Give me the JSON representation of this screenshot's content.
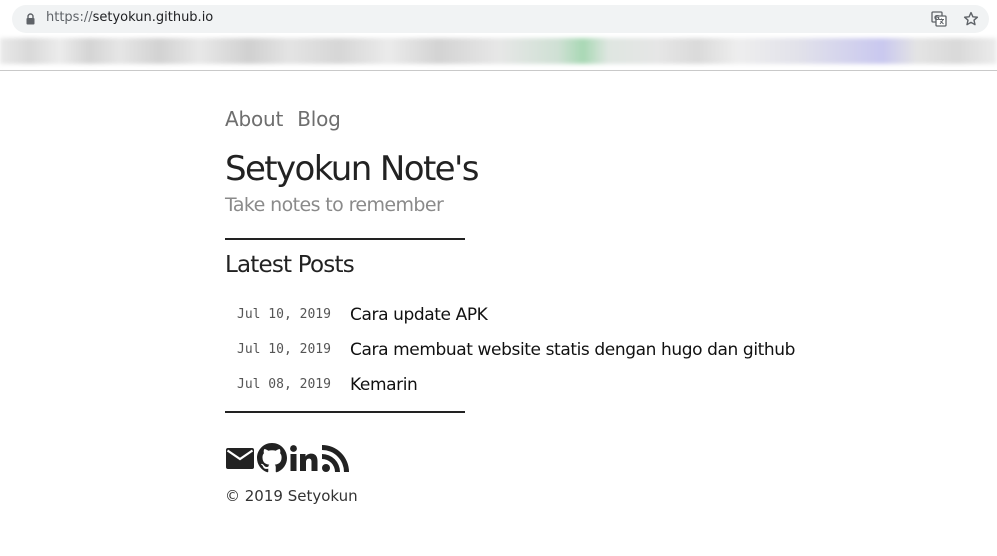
{
  "browser": {
    "url_scheme": "https://",
    "url_host": "setyokun.github.io",
    "icons": [
      "lock-icon",
      "translate-icon",
      "star-icon"
    ]
  },
  "nav": {
    "items": [
      {
        "label": "About"
      },
      {
        "label": "Blog"
      }
    ]
  },
  "site": {
    "title": "Setyokun Note's",
    "tagline": "Take notes to remember"
  },
  "latest": {
    "heading": "Latest Posts",
    "posts": [
      {
        "date": "Jul 10, 2019",
        "title": "Cara update APK"
      },
      {
        "date": "Jul 10, 2019",
        "title": "Cara membuat website statis dengan hugo dan github"
      },
      {
        "date": "Jul 08, 2019",
        "title": "Kemarin"
      }
    ]
  },
  "footer": {
    "social_icons": [
      "email-icon",
      "github-icon",
      "linkedin-icon",
      "rss-icon"
    ],
    "copyright": "© 2019 Setyokun"
  }
}
